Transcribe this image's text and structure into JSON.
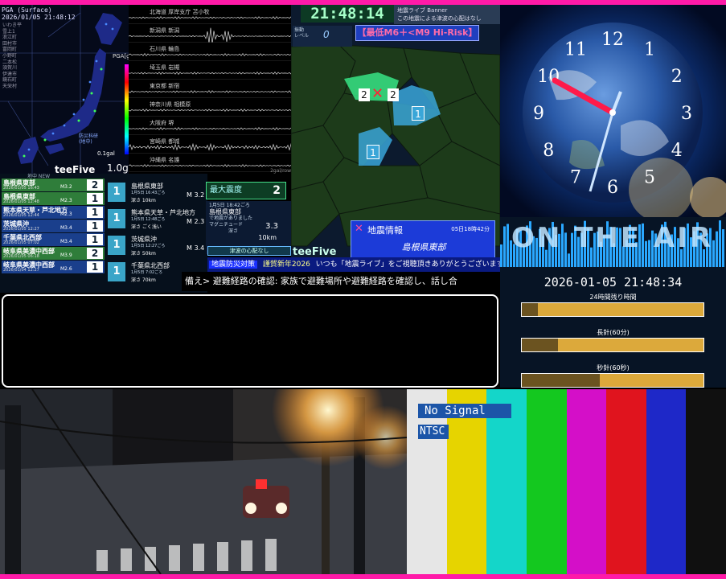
{
  "map_panel": {
    "header_line1": "PGA (Surface)",
    "header_line2": "2026/01/05 21:48:12",
    "list": [
      "いわき平",
      "雪上1",
      "浪江町",
      "田村市",
      "富岡町",
      "小野町",
      "二本松",
      "須賀川",
      "伊達市",
      "鏡石町",
      "天栄村"
    ],
    "pga_label": "PGA[gal]",
    "scale_min_label": "0.1gal",
    "scale_max_label": "1.0gal",
    "station_tag": "防災科研\n(地中)"
  },
  "seismogram_panel": {
    "stations": [
      "北海道 厚岸支庁 苫小牧",
      "新潟県 新潟",
      "石川県 輪島",
      "埼玉県 岩槻",
      "東京都 新宿",
      "神奈川県 相模原",
      "大阪府 堺",
      "宮崎県 都城",
      "沖縄県 名護"
    ],
    "footer": "2gal/row"
  },
  "regional_panel": {
    "clock": "21:48:14",
    "banner_line1": "地震ライブ Banner",
    "banner_line2": "この地震による津波の心配はなし",
    "level_label": "振動\nレベル",
    "level_value": "0",
    "risk_text": "【最低M6＋<M9 Hi-Risk】",
    "brand": "teeFive",
    "eq_title": "地震情報",
    "eq_time": "05日18時42分",
    "eq_place": "島根県東部",
    "intensity_marks": [
      "2",
      "2",
      "1",
      "1"
    ]
  },
  "quake_list": {
    "header": "地中 NEW",
    "brand": "teeFive",
    "rows": [
      {
        "name": "島根県東部",
        "time": "2026/01/05 16:43",
        "mag": "M3.2",
        "int": "2",
        "color": "#2f7d3a"
      },
      {
        "name": "島根県東部",
        "time": "2026/01/05 12:48",
        "mag": "M2.3",
        "int": "1",
        "color": "#2f7d3a"
      },
      {
        "name": "熊本県天草・芦北地方",
        "time": "2026/01/05 12:44",
        "mag": "M2.3",
        "int": "1",
        "color": "#1a3f8c"
      },
      {
        "name": "茨城県沖",
        "time": "2026/01/05 12:27",
        "mag": "M3.4",
        "int": "1",
        "color": "#1a3f8c"
      },
      {
        "name": "千葉県北西部",
        "time": "2026/01/05 07:02",
        "mag": "M3.4",
        "int": "1",
        "color": "#1a3f8c"
      },
      {
        "name": "岐阜県美濃中西部",
        "time": "2026/01/05 06:18",
        "mag": "M3.9",
        "int": "2",
        "color": "#2f7d3a"
      },
      {
        "name": "岐阜県美濃中西部",
        "time": "2026/01/04 12:27",
        "mag": "M2.6",
        "int": "1",
        "color": "#1a3f8c"
      }
    ],
    "details": [
      {
        "name": "島根県東部",
        "time": "1月5日 16:43ごろ",
        "depth": "深さ 10km",
        "mag": "M 3.2",
        "int": "1"
      },
      {
        "name": "熊本県天草・芦北地方",
        "time": "1月5日 12:48ごろ",
        "depth": "深さ ごく浅い",
        "mag": "M 2.3",
        "int": "1"
      },
      {
        "name": "茨城県沖",
        "time": "1月5日 12:27ごろ",
        "depth": "深さ 50km",
        "mag": "M 3.4",
        "int": "1"
      },
      {
        "name": "千葉県北西部",
        "time": "1月5日 7:02ごろ",
        "depth": "深さ 70km",
        "mag": "M 3.4",
        "int": "1"
      }
    ],
    "max_intensity_label": "最大震度",
    "max_intensity_value": "2",
    "detail_time": "1月5日 18:42ごろ",
    "detail_place": "島根県東部",
    "detail_note": "で地震がありました",
    "detail_mag_label": "マグニチュード",
    "detail_mag_value": "3.3",
    "detail_depth_label": "深さ",
    "detail_depth_value": "10km",
    "tsunami": "津波の心配なし"
  },
  "ticker": {
    "tag": "地震防災対策",
    "year": "謹賀新年2026",
    "message": "いつも「地震ライブ」をご視聴頂きありがとうございます!",
    "line2": "備え> 避難経路の確認: 家族で避難場所や避難経路を確認し、話し合"
  },
  "analog_clock": {
    "numerals": [
      "12",
      "1",
      "2",
      "3",
      "4",
      "5",
      "6",
      "7",
      "8",
      "9",
      "10",
      "11"
    ]
  },
  "onair_panel": {
    "title": "ON THE AIR",
    "datetime": "2026-01-05 21:48:34",
    "bars": [
      {
        "label": "24時間残り時間",
        "fraction": 0.09
      },
      {
        "label": "長針(60分)",
        "fraction": 0.2
      },
      {
        "label": "秒針(60秒)",
        "fraction": 0.43
      }
    ]
  },
  "no_signal_panel": {
    "label": "No Signal",
    "format": "NTSC",
    "bar_colors": [
      "#e6e6e6",
      "#e6d400",
      "#14d6c9",
      "#14c81f",
      "#d40fc8",
      "#e0141e",
      "#1e28c8",
      "#101010"
    ]
  }
}
